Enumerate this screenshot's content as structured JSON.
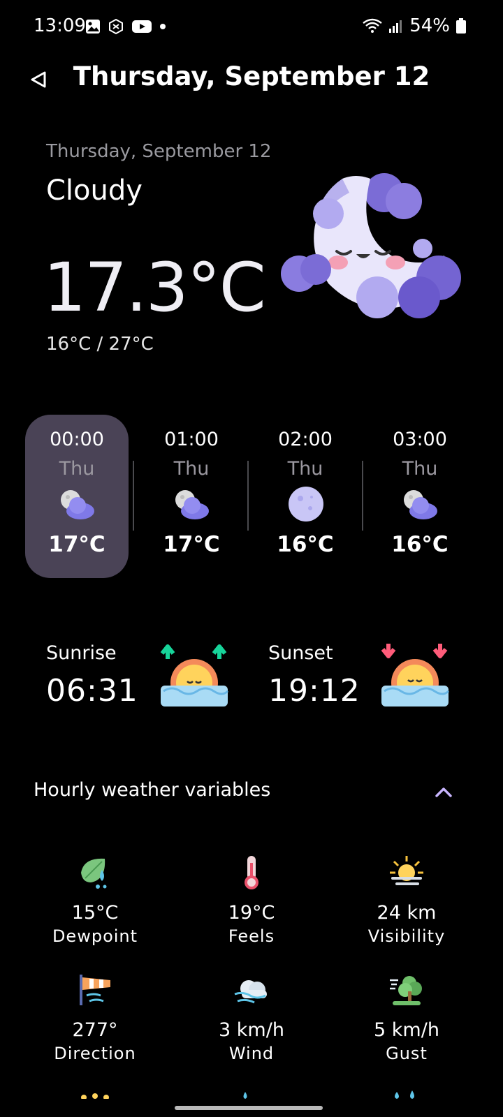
{
  "status_bar": {
    "time": "13:09",
    "battery": "54%"
  },
  "header": {
    "title": "Thursday, September 12"
  },
  "current": {
    "date": "Thursday, September 12",
    "condition": "Cloudy",
    "temperature": "17.3°C",
    "range": "16°C / 27°C"
  },
  "hourly": [
    {
      "time": "00:00",
      "day": "Thu",
      "temp": "17°C",
      "icon": "moon-cloud-icon"
    },
    {
      "time": "01:00",
      "day": "Thu",
      "temp": "17°C",
      "icon": "moon-cloud-icon"
    },
    {
      "time": "02:00",
      "day": "Thu",
      "temp": "16°C",
      "icon": "moon-icon"
    },
    {
      "time": "03:00",
      "day": "Thu",
      "temp": "16°C",
      "icon": "moon-cloud-icon"
    }
  ],
  "sun": {
    "sunrise_label": "Sunrise",
    "sunrise_time": "06:31",
    "sunset_label": "Sunset",
    "sunset_time": "19:12"
  },
  "variables": {
    "title": "Hourly weather variables",
    "items": [
      {
        "value": "15°C",
        "label": "Dewpoint",
        "icon": "dewpoint-icon"
      },
      {
        "value": "19°C",
        "label": "Feels",
        "icon": "thermometer-icon"
      },
      {
        "value": "24 km",
        "label": "Visibility",
        "icon": "visibility-icon"
      },
      {
        "value": "277°",
        "label": "Direction",
        "icon": "windsock-icon"
      },
      {
        "value": "3 km/h",
        "label": "Wind",
        "icon": "wind-icon"
      },
      {
        "value": "5 km/h",
        "label": "Gust",
        "icon": "gust-icon"
      }
    ]
  },
  "colors": {
    "background": "#000000",
    "selected_card": "#4a4356",
    "accent_lavender": "#c9b6ff",
    "sunrise_arrow": "#17d49a",
    "sunset_arrow": "#ff5c7a"
  }
}
